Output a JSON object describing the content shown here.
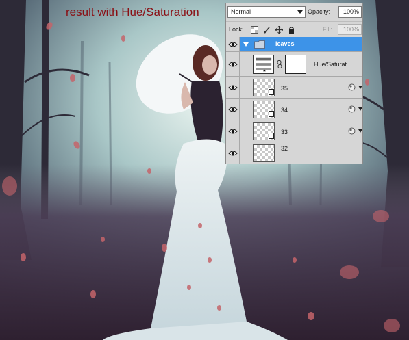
{
  "caption": "result with Hue/Saturation",
  "layers_panel": {
    "blend_mode": "Normal",
    "opacity_label": "Opacity:",
    "opacity_value": "100%",
    "lock_label": "Lock:",
    "fill_label": "Fill:",
    "fill_value": "100%",
    "lock_icons": [
      "lock-transparent-pixels-icon",
      "lock-image-pixels-icon",
      "lock-position-icon",
      "lock-all-icon"
    ],
    "selected_color": "#3d93e8",
    "layers": [
      {
        "name": "leaves",
        "type": "group",
        "expanded": true,
        "selected": true,
        "visible": true
      },
      {
        "name": "Hue/Saturat...",
        "type": "adjustment",
        "visible": true
      },
      {
        "name": "35",
        "type": "pixel",
        "visible": true
      },
      {
        "name": "34",
        "type": "pixel",
        "visible": true
      },
      {
        "name": "33",
        "type": "pixel",
        "visible": true
      },
      {
        "name": "32",
        "type": "pixel",
        "visible": true
      }
    ]
  },
  "colors": {
    "caption": "#8a0f14",
    "fog": "#cfe3e0",
    "ground": "#3a2c3a",
    "leaf": "#c4646a"
  }
}
